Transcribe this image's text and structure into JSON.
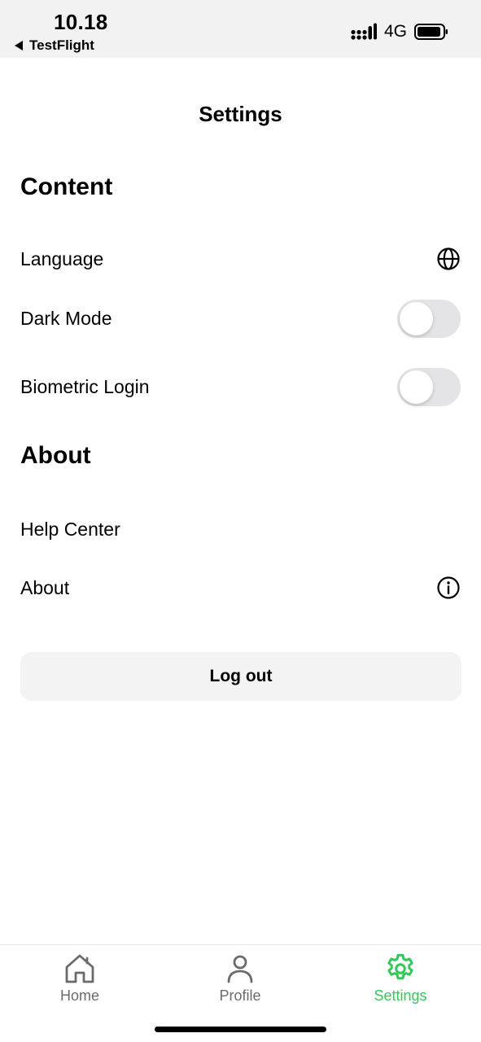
{
  "status_bar": {
    "time": "10.18",
    "back_app": "TestFlight",
    "network": "4G",
    "signal_icon": "signal-bars-icon",
    "battery_icon": "battery-icon"
  },
  "header": {
    "title": "Settings"
  },
  "sections": {
    "content": {
      "title": "Content",
      "language": {
        "label": "Language",
        "icon": "globe-icon"
      },
      "dark_mode": {
        "label": "Dark Mode",
        "enabled": false
      },
      "biometric_login": {
        "label": "Biometric Login",
        "enabled": false
      }
    },
    "about": {
      "title": "About",
      "help_center": {
        "label": "Help Center"
      },
      "about_item": {
        "label": "About",
        "icon": "info-icon"
      }
    }
  },
  "logout": {
    "label": "Log out"
  },
  "tabbar": {
    "active": "Settings",
    "accent_color": "#34c759",
    "items": [
      {
        "label": "Home",
        "icon": "home-icon"
      },
      {
        "label": "Profile",
        "icon": "user-icon"
      },
      {
        "label": "Settings",
        "icon": "gear-icon"
      }
    ]
  }
}
